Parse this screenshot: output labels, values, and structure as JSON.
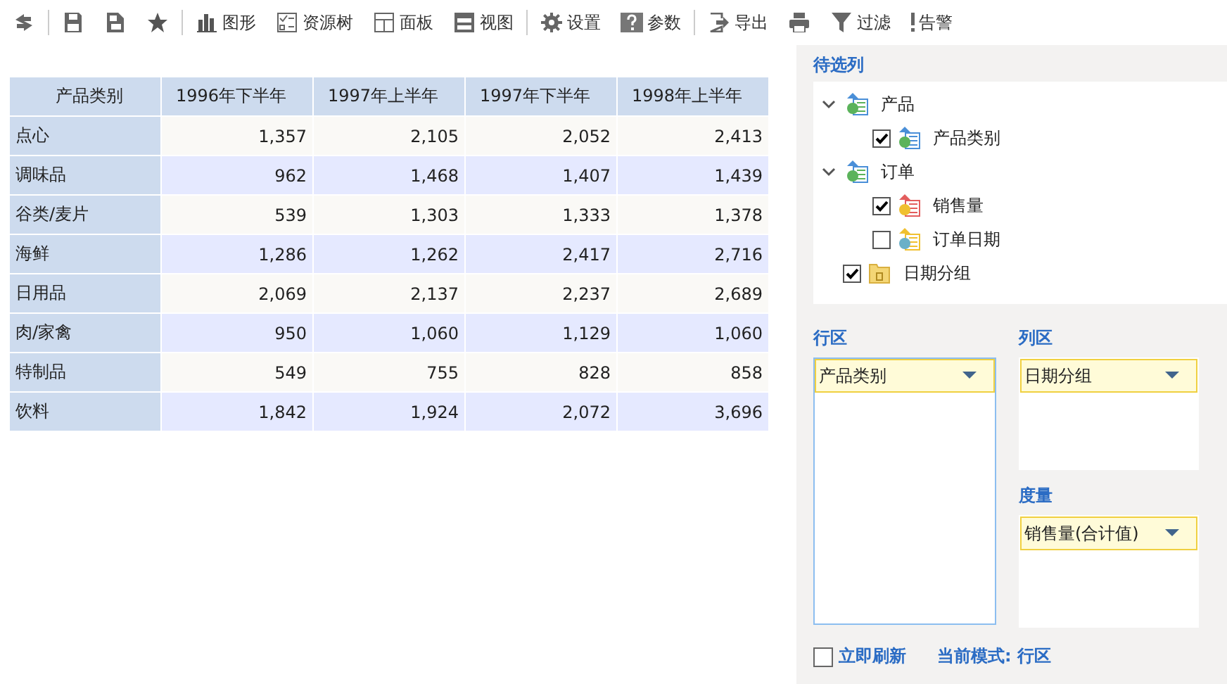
{
  "toolbar": [
    {
      "kind": "button"
    },
    {
      "kind": "separator"
    },
    {
      "kind": "button"
    },
    {
      "kind": "button"
    },
    {
      "kind": "button"
    },
    {
      "kind": "separator"
    },
    {
      "kind": "button",
      "label": "图形"
    },
    {
      "kind": "button",
      "label": "资源树"
    },
    {
      "kind": "button",
      "label": "面板"
    },
    {
      "kind": "button",
      "label": "视图"
    },
    {
      "kind": "separator"
    },
    {
      "kind": "button",
      "label": "设置"
    },
    {
      "kind": "button",
      "label": "参数"
    },
    {
      "kind": "separator"
    },
    {
      "kind": "button",
      "label": "导出"
    },
    {
      "kind": "button"
    },
    {
      "kind": "button",
      "label": "过滤"
    },
    {
      "kind": "button",
      "label": "告警"
    }
  ],
  "table": {
    "columns": [
      "产品类别",
      "1996年下半年",
      "1997年上半年",
      "1997年下半年",
      "1998年上半年"
    ],
    "rows": [
      [
        "点心",
        "1,357",
        "2,105",
        "2,052",
        "2,413"
      ],
      [
        "调味品",
        "962",
        "1,468",
        "1,407",
        "1,439"
      ],
      [
        "谷类/麦片",
        "539",
        "1,303",
        "1,333",
        "1,378"
      ],
      [
        "海鲜",
        "1,286",
        "1,262",
        "2,417",
        "2,716"
      ],
      [
        "日用品",
        "2,069",
        "2,137",
        "2,237",
        "2,689"
      ],
      [
        "肉/家禽",
        "950",
        "1,060",
        "1,129",
        "1,060"
      ],
      [
        "特制品",
        "549",
        "755",
        "828",
        "858"
      ],
      [
        "饮料",
        "1,842",
        "1,924",
        "2,072",
        "3,696"
      ]
    ]
  },
  "candidates": {
    "title": "待选列",
    "items": [
      {
        "label": "产品",
        "kind": "table",
        "expanded": true,
        "children": [
          {
            "label": "产品类别",
            "kind": "dimension",
            "checked": true
          }
        ]
      },
      {
        "label": "订单",
        "kind": "table",
        "expanded": true,
        "children": [
          {
            "label": "销售量",
            "kind": "measure",
            "checked": true
          },
          {
            "label": "订单日期",
            "kind": "date",
            "checked": false
          }
        ]
      },
      {
        "label": "日期分组",
        "kind": "folder",
        "checked": true
      }
    ]
  },
  "zones": [
    {
      "kind": "row",
      "title": "行区",
      "selected": true,
      "fields": [
        "产品类别"
      ]
    },
    {
      "kind": "column",
      "title": "列区",
      "selected": false,
      "fields": [
        "日期分组"
      ]
    },
    {
      "kind": "measure",
      "title": "度量",
      "selected": false,
      "fields": [
        "销售量(合计值)"
      ]
    }
  ],
  "footer": {
    "refresh": {
      "label": "立即刷新",
      "checked": false
    },
    "mode": "当前模式: 行区"
  }
}
